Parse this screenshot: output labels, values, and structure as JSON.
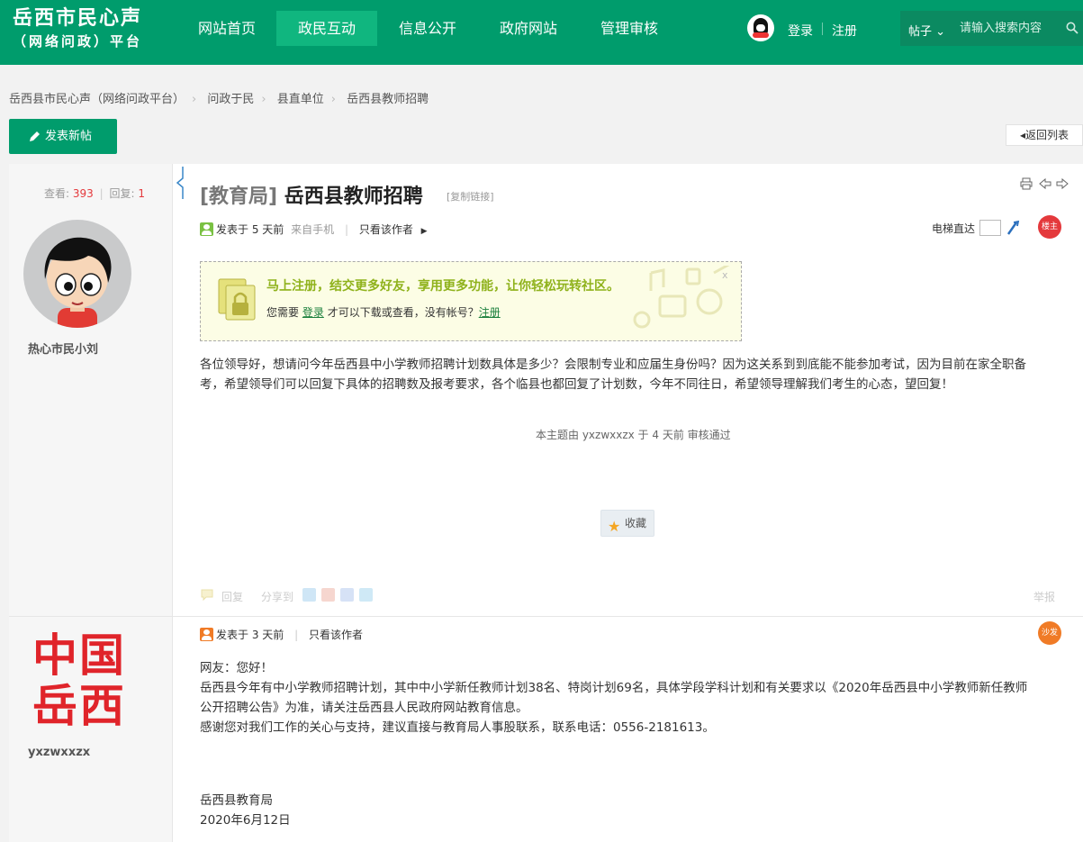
{
  "header": {
    "logo_line1": "岳西市民心声",
    "logo_line2": "（网络问政）平台",
    "nav": [
      "网站首页",
      "政民互动",
      "信息公开",
      "政府网站",
      "管理审核"
    ],
    "login": "登录",
    "register": "注册",
    "search_type": "帖子",
    "search_placeholder": "请输入搜索内容"
  },
  "breadcrumb": [
    "岳西县市民心声（网络问政平台）",
    "问政于民",
    "县直单位",
    "岳西县教师招聘"
  ],
  "actions": {
    "new_post": "发表新帖",
    "back_to_list": "返回列表"
  },
  "thread": {
    "views_label": "查看:",
    "views": "393",
    "replies_label": "回复:",
    "replies": "1",
    "category": "[教育局]",
    "title": "岳西县教师招聘",
    "copy_link": "[复制链接]"
  },
  "post1": {
    "author": "热心市民小刘",
    "posted": "发表于 5 天前",
    "source": "来自手机",
    "only_author": "只看该作者",
    "elevator_label": "电梯直达",
    "floor_badge": "楼主",
    "notice_headline": "马上注册，结交更多好友，享用更多功能，让你轻松玩转社区。",
    "notice_prefix": "您需要",
    "notice_login": "登录",
    "notice_middle": "才可以下载或查看，没有帐号？",
    "notice_register": "注册",
    "notice_close": "x",
    "body_line1": "各位领导好，想请问今年岳西县中小学教师招聘计划数具体是多少？会限制专业和应届生身份吗？因为这关系到到底能不能参加考试，因为目前在家全职备",
    "body_line2": "考，希望领导们可以回复下具体的招聘数及报考要求，各个临县也都回复了计划数，今年不同往日，希望领导理解我们考生的心态，望回复！",
    "review_note": "本主题由 yxzwxxzx 于 4 天前 审核通过",
    "favorite": "收藏",
    "reply": "回复",
    "share_to": "分享到",
    "report": "举报"
  },
  "post2": {
    "author": "yxzwxxzx",
    "logo_text_top": "中国",
    "logo_text_bottom": "岳西",
    "posted": "发表于 3 天前",
    "only_author": "只看该作者",
    "floor_badge": "沙发",
    "lines": [
      "网友：您好！",
      "岳西县今年有中小学教师招聘计划，其中中小学新任教师计划38名、特岗计划69名，具体学段学科计划和有关要求以《2020年岳西县中小学教师新任教师",
      "公开招聘公告》为准，请关注岳西县人民政府网站教育信息。",
      "感谢您对我们工作的关心与支持，建议直接与教育局人事股联系，联系电话：0556-2181613。"
    ],
    "sign_org": "岳西县教育局",
    "sign_date": "2020年6月12日"
  },
  "colors": {
    "brand": "#009c6c",
    "nav_active": "#10b67f",
    "accent_red": "#e4393c",
    "badge_orange": "#f07b26"
  }
}
